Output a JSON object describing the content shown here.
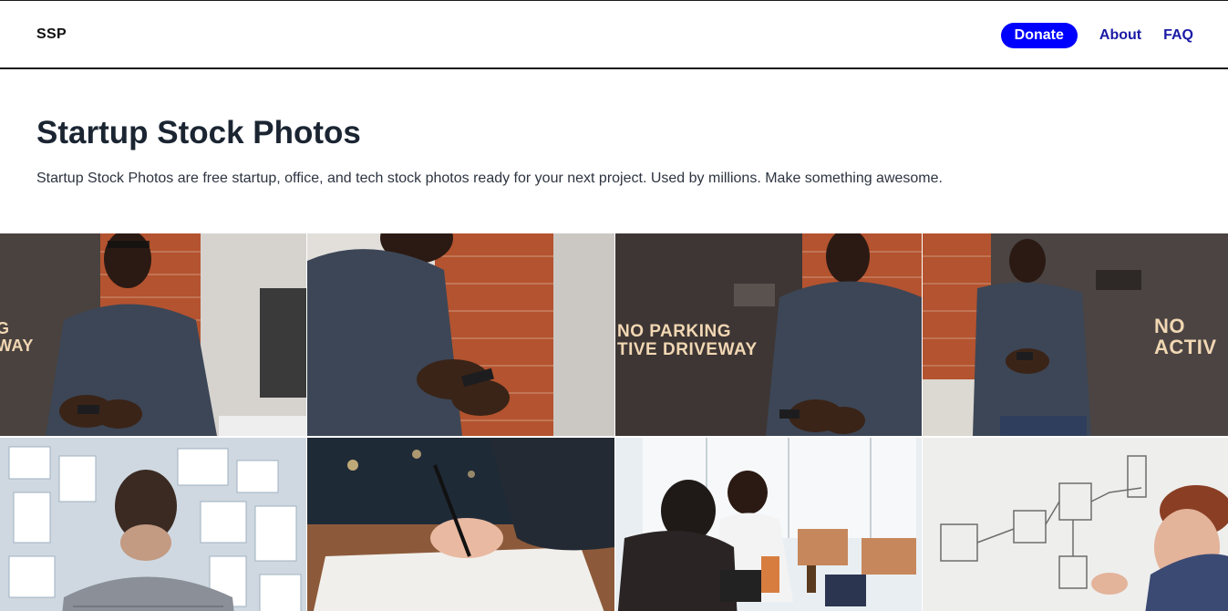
{
  "header": {
    "logo": "SSP",
    "nav": {
      "donate": "Donate",
      "about": "About",
      "faq": "FAQ"
    }
  },
  "hero": {
    "title": "Startup Stock Photos",
    "subtitle": "Startup Stock Photos are free startup, office, and tech stock photos ready for your next project. Used by millions. Make something awesome."
  },
  "gallery": {
    "photos": [
      {
        "subject": "man-with-phone-by-wall",
        "sign": [
          "G",
          "WAY"
        ]
      },
      {
        "subject": "man-texting-closeup",
        "sign": []
      },
      {
        "subject": "man-with-phone-no-parking",
        "sign": [
          "NO PARKING",
          "TIVE DRIVEWAY"
        ]
      },
      {
        "subject": "man-leaning-on-door",
        "sign": [
          "NO",
          "ACTIV"
        ]
      },
      {
        "subject": "man-facing-moodboard",
        "sign": []
      },
      {
        "subject": "hand-drawing-with-pen",
        "sign": []
      },
      {
        "subject": "people-working-on-laptops",
        "sign": []
      },
      {
        "subject": "man-drawing-on-whiteboard",
        "sign": []
      }
    ]
  },
  "colors": {
    "donate_bg": "#0000ff",
    "nav_link": "#1a1aa6",
    "title": "#1b2532",
    "shirt": "#3c4656",
    "brick": "#b4532f",
    "door": "#3e3634"
  }
}
